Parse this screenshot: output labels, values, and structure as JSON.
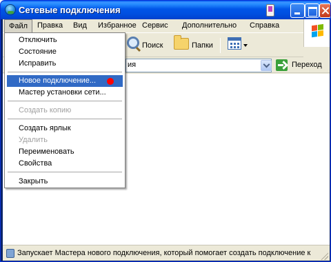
{
  "window": {
    "title": "Сетевые подключения",
    "minimize_label": "_",
    "maximize_label": "",
    "close_label": ""
  },
  "menubar": {
    "items": [
      {
        "label": "Файл"
      },
      {
        "label": "Правка"
      },
      {
        "label": "Вид"
      },
      {
        "label": "Избранное"
      },
      {
        "label": "Сервис"
      },
      {
        "label": "Дополнительно"
      },
      {
        "label": "Справка"
      }
    ]
  },
  "toolbar": {
    "search_label": "Поиск",
    "folders_label": "Папки",
    "views_icon": "views-icon"
  },
  "addressbar": {
    "value": "ия",
    "go_label": "Переход"
  },
  "file_menu": {
    "items": [
      {
        "label": "Отключить",
        "disabled": false
      },
      {
        "label": "Состояние",
        "disabled": false
      },
      {
        "label": "Исправить",
        "disabled": false
      },
      {
        "label": "Новое подключение...",
        "disabled": false,
        "highlighted": true
      },
      {
        "label": "Мастер установки сети...",
        "disabled": false
      },
      {
        "label": "Создать копию",
        "disabled": true
      },
      {
        "label": "Создать ярлык",
        "disabled": false
      },
      {
        "label": "Удалить",
        "disabled": true
      },
      {
        "label": "Переименовать",
        "disabled": false
      },
      {
        "label": "Свойства",
        "disabled": false
      },
      {
        "label": "Закрыть",
        "disabled": false
      }
    ],
    "highlight_color": "#316AC5"
  },
  "statusbar": {
    "text": "Запускает Мастера нового подключения, который помогает создать подключение к"
  },
  "colors": {
    "titlebar": "#0055E8",
    "chrome": "#ECE9D8",
    "selection": "#316AC5",
    "marker_dot": "#FF0000"
  }
}
